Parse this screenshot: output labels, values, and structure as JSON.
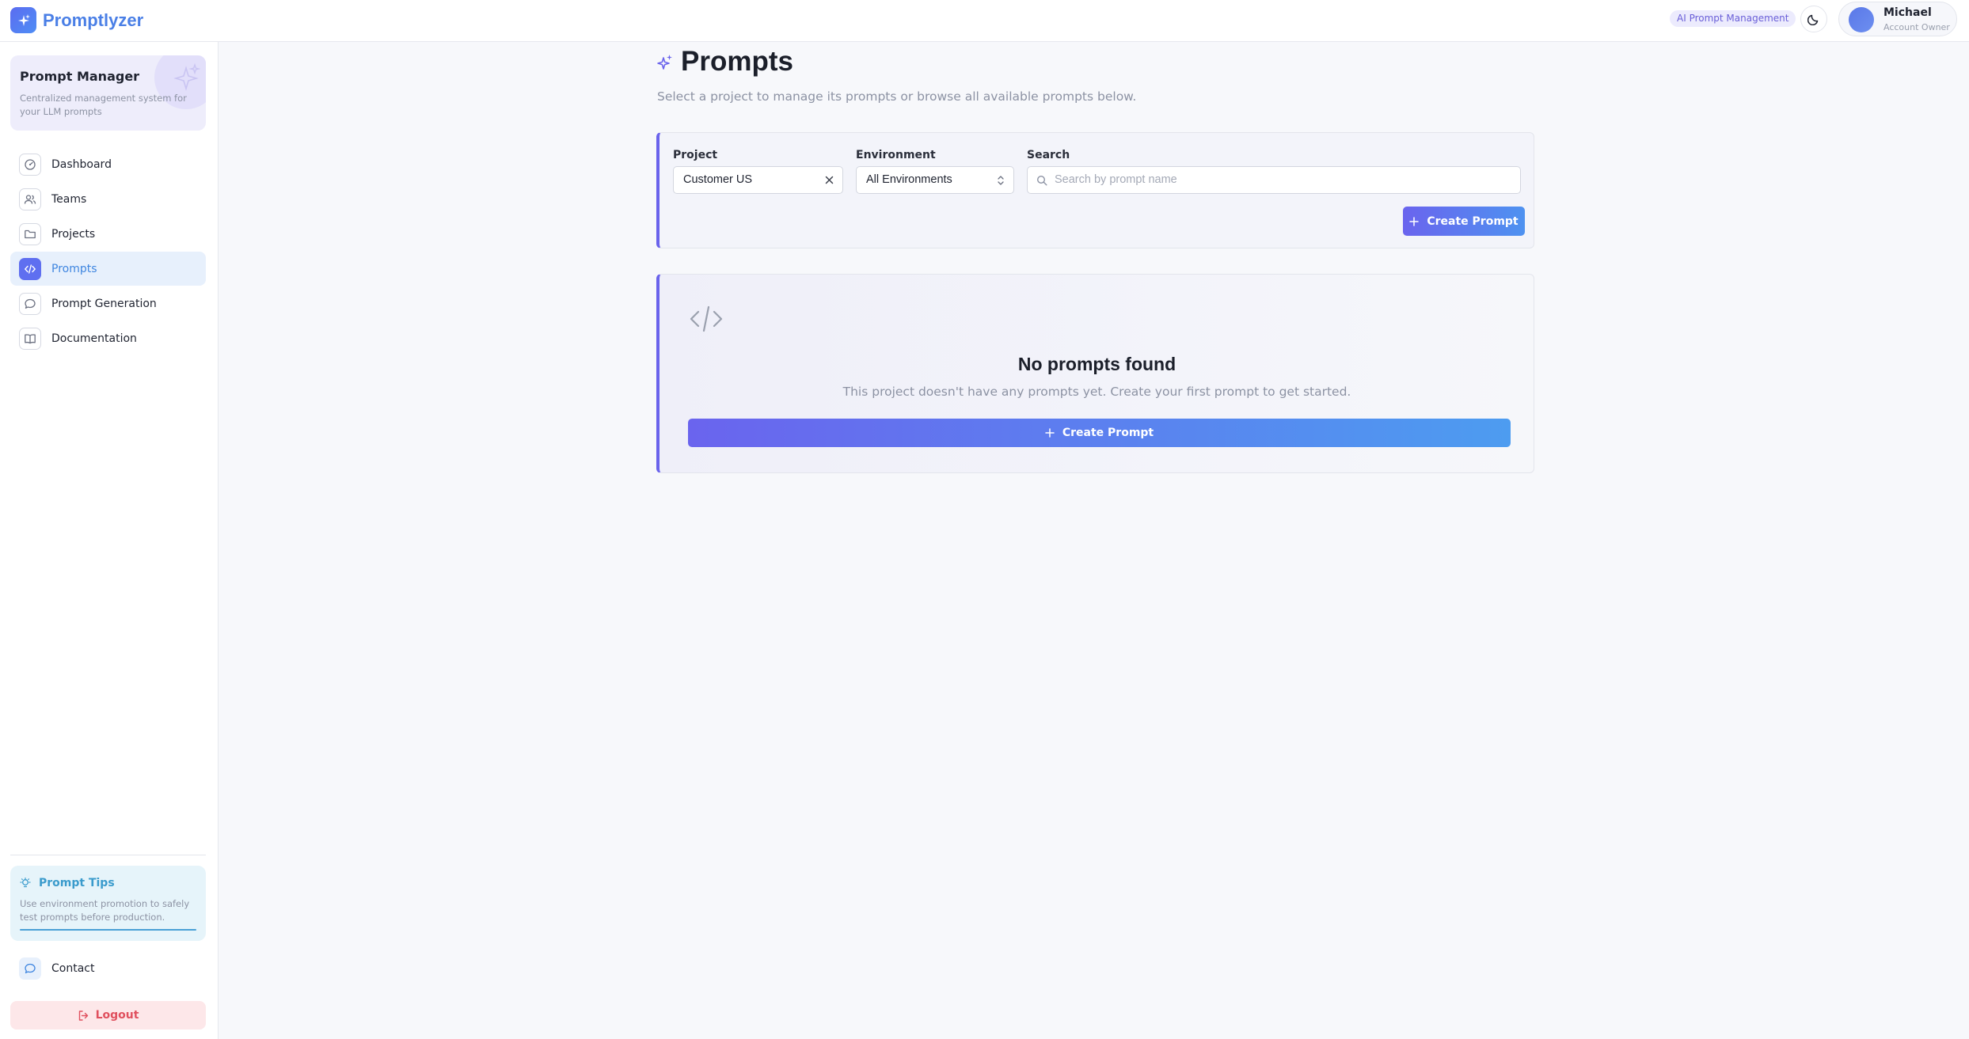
{
  "header": {
    "brand": "Promptlyzer",
    "tag": "AI Prompt Management",
    "user_name": "Michael",
    "user_role": "Account Owner"
  },
  "sidebar": {
    "card_title": "Prompt Manager",
    "card_desc": "Centralized management system for your LLM prompts",
    "items": [
      {
        "label": "Dashboard",
        "icon": "dashboard-icon"
      },
      {
        "label": "Teams",
        "icon": "users-icon"
      },
      {
        "label": "Projects",
        "icon": "folder-icon"
      },
      {
        "label": "Prompts",
        "icon": "code-icon",
        "active": true
      },
      {
        "label": "Prompt Generation",
        "icon": "chat-bubble-icon"
      },
      {
        "label": "Documentation",
        "icon": "book-icon"
      }
    ],
    "tips_title": "Prompt Tips",
    "tips_text": "Use environment promotion to safely test prompts before production.",
    "contact": "Contact",
    "logout": "Logout"
  },
  "main": {
    "title": "Prompts",
    "subtitle": "Select a project to manage its prompts or browse all available prompts below.",
    "filters": {
      "project_label": "Project",
      "project_value": "Customer US",
      "environment_label": "Environment",
      "environment_value": "All Environments",
      "search_label": "Search",
      "search_placeholder": "Search by prompt name"
    },
    "create_button": "Create Prompt",
    "empty": {
      "title": "No prompts found",
      "desc": "This project doesn't have any prompts yet. Create your first prompt to get started.",
      "button": "Create Prompt"
    }
  },
  "colors": {
    "accent": "#6a63ec",
    "brand": "#4a7fe6",
    "active_nav_bg": "#e7f0fc",
    "logout": "#e0505e"
  }
}
